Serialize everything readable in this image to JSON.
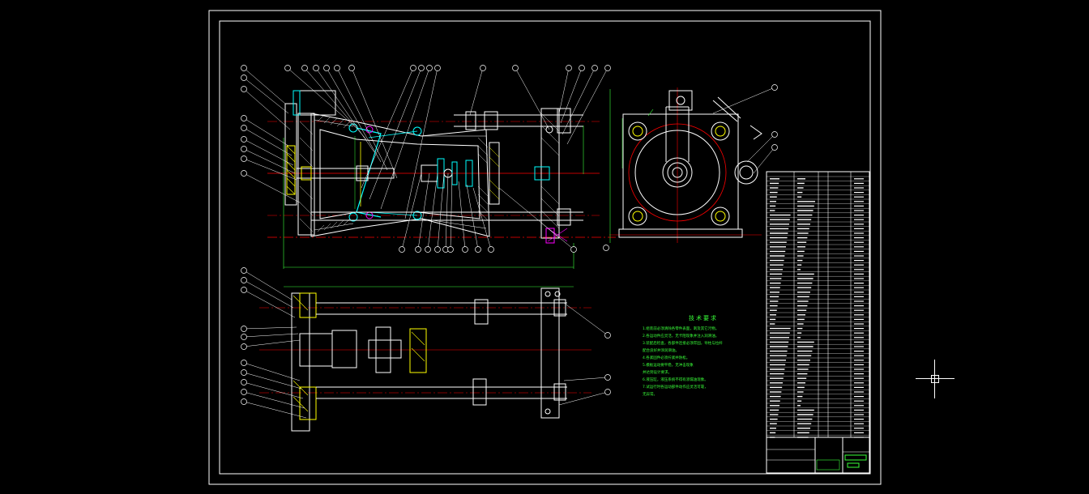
{
  "drawing": {
    "notes_title": "技术要求",
    "notes": [
      "1.组装前必须清除各零件表面，刺及其它污物。",
      "2.各运动件应灵活，无卡阻现象并注入润滑油。",
      "3.装配后检查，各部件连接必须牢固，导柱与拉杆",
      "  配合良好并涂润滑油。",
      "4.各紧固件必须拧紧并防松。",
      "5.模板运动要平稳，无冲击现象",
      "  并达到设计要求。",
      "6.液压缸，液压系统不得有渗漏油现象。",
      "7.试运行时各运动部件动作应灵活可靠，",
      "  无异常。"
    ],
    "colors": {
      "background": "#000000",
      "outline": "#ffffff",
      "centerline": "#ff0000",
      "hidden": "#00ffff",
      "hatch": "#ffff00",
      "text": "#39ff39",
      "dimension": "#39ff39",
      "highlight": "#ff00ff"
    }
  }
}
